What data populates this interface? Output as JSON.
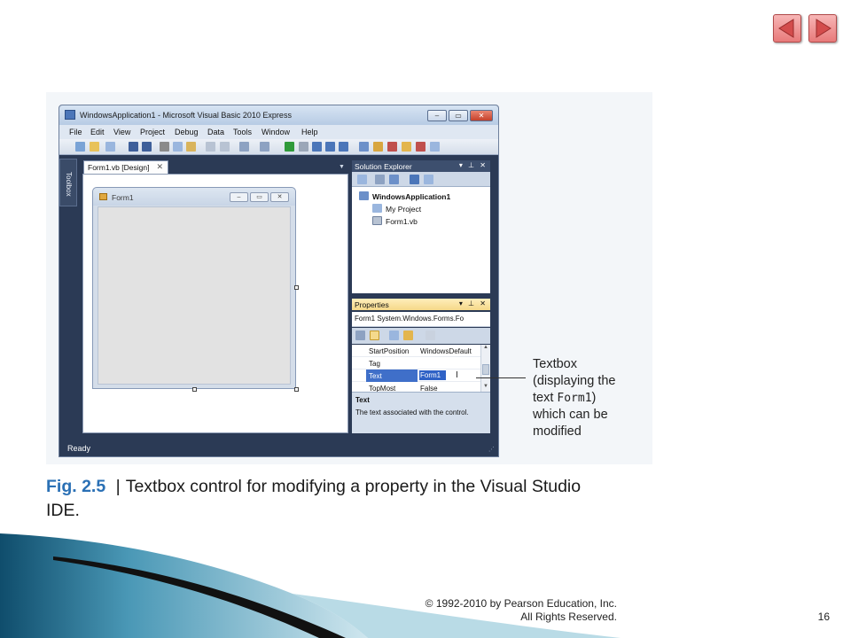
{
  "nav": {
    "prev_icon": "triangle-left-icon",
    "next_icon": "triangle-right-icon",
    "button_color": "#e87a7a"
  },
  "window": {
    "title": "WindowsApplication1 - Microsoft Visual Basic 2010 Express",
    "controls": [
      "minimize-icon",
      "maximize-icon",
      "close-icon"
    ]
  },
  "menu": [
    "File",
    "Edit",
    "View",
    "Project",
    "Debug",
    "Data",
    "Tools",
    "Window",
    "Help"
  ],
  "toolbox": {
    "label": "Toolbox"
  },
  "editor": {
    "tab_label": "Form1.vb [Design]",
    "tab_close": "✕"
  },
  "form": {
    "title": "Form1"
  },
  "solution_explorer": {
    "title": "Solution Explorer",
    "items": [
      "WindowsApplication1",
      "My Project",
      "Form1.vb"
    ]
  },
  "properties": {
    "title": "Properties",
    "object": "Form1 System.Windows.Forms.Fo",
    "rows": [
      {
        "name": "StartPosition",
        "value": "WindowsDefault"
      },
      {
        "name": "Tag",
        "value": ""
      },
      {
        "name": "Text",
        "value": "Form1"
      },
      {
        "name": "TopMost",
        "value": "False"
      }
    ],
    "description_title": "Text",
    "description": "The text associated with the control."
  },
  "status": "Ready",
  "callout": {
    "lines": [
      "Textbox",
      "(displaying the",
      "which can be",
      "modified"
    ],
    "text_prefix": "text ",
    "code": "Form1",
    "text_suffix": ")"
  },
  "caption": {
    "label": "Fig. 2.5",
    "separator": "|",
    "text": "Textbox control for modifying a property in the Visual Studio IDE."
  },
  "footer": {
    "copyright_line1": "© 1992-2010 by Pearson Education, Inc.",
    "copyright_line2": "All Rights Reserved.",
    "page": "16"
  }
}
